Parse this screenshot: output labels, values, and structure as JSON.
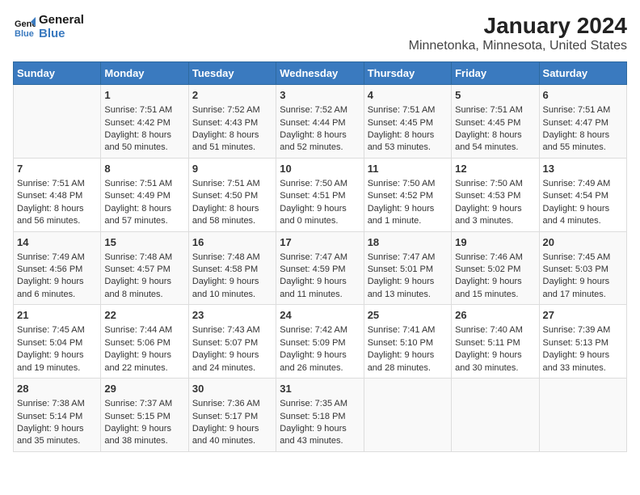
{
  "header": {
    "logo_line1": "General",
    "logo_line2": "Blue",
    "title": "January 2024",
    "subtitle": "Minnetonka, Minnesota, United States"
  },
  "days_of_week": [
    "Sunday",
    "Monday",
    "Tuesday",
    "Wednesday",
    "Thursday",
    "Friday",
    "Saturday"
  ],
  "weeks": [
    [
      {
        "day": "",
        "content": ""
      },
      {
        "day": "1",
        "content": "Sunrise: 7:51 AM\nSunset: 4:42 PM\nDaylight: 8 hours\nand 50 minutes."
      },
      {
        "day": "2",
        "content": "Sunrise: 7:52 AM\nSunset: 4:43 PM\nDaylight: 8 hours\nand 51 minutes."
      },
      {
        "day": "3",
        "content": "Sunrise: 7:52 AM\nSunset: 4:44 PM\nDaylight: 8 hours\nand 52 minutes."
      },
      {
        "day": "4",
        "content": "Sunrise: 7:51 AM\nSunset: 4:45 PM\nDaylight: 8 hours\nand 53 minutes."
      },
      {
        "day": "5",
        "content": "Sunrise: 7:51 AM\nSunset: 4:45 PM\nDaylight: 8 hours\nand 54 minutes."
      },
      {
        "day": "6",
        "content": "Sunrise: 7:51 AM\nSunset: 4:47 PM\nDaylight: 8 hours\nand 55 minutes."
      }
    ],
    [
      {
        "day": "7",
        "content": "Sunrise: 7:51 AM\nSunset: 4:48 PM\nDaylight: 8 hours\nand 56 minutes."
      },
      {
        "day": "8",
        "content": "Sunrise: 7:51 AM\nSunset: 4:49 PM\nDaylight: 8 hours\nand 57 minutes."
      },
      {
        "day": "9",
        "content": "Sunrise: 7:51 AM\nSunset: 4:50 PM\nDaylight: 8 hours\nand 58 minutes."
      },
      {
        "day": "10",
        "content": "Sunrise: 7:50 AM\nSunset: 4:51 PM\nDaylight: 9 hours\nand 0 minutes."
      },
      {
        "day": "11",
        "content": "Sunrise: 7:50 AM\nSunset: 4:52 PM\nDaylight: 9 hours\nand 1 minute."
      },
      {
        "day": "12",
        "content": "Sunrise: 7:50 AM\nSunset: 4:53 PM\nDaylight: 9 hours\nand 3 minutes."
      },
      {
        "day": "13",
        "content": "Sunrise: 7:49 AM\nSunset: 4:54 PM\nDaylight: 9 hours\nand 4 minutes."
      }
    ],
    [
      {
        "day": "14",
        "content": "Sunrise: 7:49 AM\nSunset: 4:56 PM\nDaylight: 9 hours\nand 6 minutes."
      },
      {
        "day": "15",
        "content": "Sunrise: 7:48 AM\nSunset: 4:57 PM\nDaylight: 9 hours\nand 8 minutes."
      },
      {
        "day": "16",
        "content": "Sunrise: 7:48 AM\nSunset: 4:58 PM\nDaylight: 9 hours\nand 10 minutes."
      },
      {
        "day": "17",
        "content": "Sunrise: 7:47 AM\nSunset: 4:59 PM\nDaylight: 9 hours\nand 11 minutes."
      },
      {
        "day": "18",
        "content": "Sunrise: 7:47 AM\nSunset: 5:01 PM\nDaylight: 9 hours\nand 13 minutes."
      },
      {
        "day": "19",
        "content": "Sunrise: 7:46 AM\nSunset: 5:02 PM\nDaylight: 9 hours\nand 15 minutes."
      },
      {
        "day": "20",
        "content": "Sunrise: 7:45 AM\nSunset: 5:03 PM\nDaylight: 9 hours\nand 17 minutes."
      }
    ],
    [
      {
        "day": "21",
        "content": "Sunrise: 7:45 AM\nSunset: 5:04 PM\nDaylight: 9 hours\nand 19 minutes."
      },
      {
        "day": "22",
        "content": "Sunrise: 7:44 AM\nSunset: 5:06 PM\nDaylight: 9 hours\nand 22 minutes."
      },
      {
        "day": "23",
        "content": "Sunrise: 7:43 AM\nSunset: 5:07 PM\nDaylight: 9 hours\nand 24 minutes."
      },
      {
        "day": "24",
        "content": "Sunrise: 7:42 AM\nSunset: 5:09 PM\nDaylight: 9 hours\nand 26 minutes."
      },
      {
        "day": "25",
        "content": "Sunrise: 7:41 AM\nSunset: 5:10 PM\nDaylight: 9 hours\nand 28 minutes."
      },
      {
        "day": "26",
        "content": "Sunrise: 7:40 AM\nSunset: 5:11 PM\nDaylight: 9 hours\nand 30 minutes."
      },
      {
        "day": "27",
        "content": "Sunrise: 7:39 AM\nSunset: 5:13 PM\nDaylight: 9 hours\nand 33 minutes."
      }
    ],
    [
      {
        "day": "28",
        "content": "Sunrise: 7:38 AM\nSunset: 5:14 PM\nDaylight: 9 hours\nand 35 minutes."
      },
      {
        "day": "29",
        "content": "Sunrise: 7:37 AM\nSunset: 5:15 PM\nDaylight: 9 hours\nand 38 minutes."
      },
      {
        "day": "30",
        "content": "Sunrise: 7:36 AM\nSunset: 5:17 PM\nDaylight: 9 hours\nand 40 minutes."
      },
      {
        "day": "31",
        "content": "Sunrise: 7:35 AM\nSunset: 5:18 PM\nDaylight: 9 hours\nand 43 minutes."
      },
      {
        "day": "",
        "content": ""
      },
      {
        "day": "",
        "content": ""
      },
      {
        "day": "",
        "content": ""
      }
    ]
  ]
}
